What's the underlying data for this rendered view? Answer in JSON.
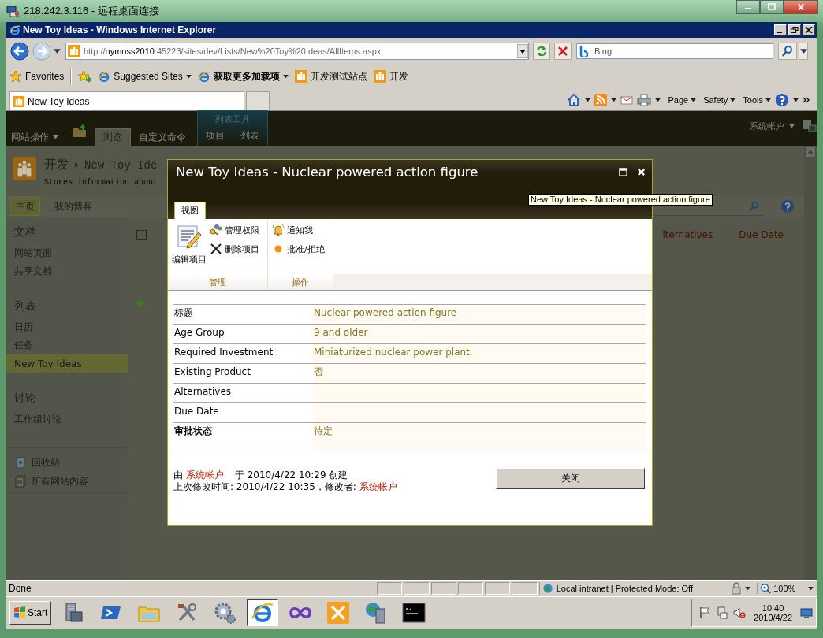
{
  "remote_window": {
    "title": "218.242.3.116 - 远程桌面连接"
  },
  "browser": {
    "title": "New Toy Ideas - Windows Internet Explorer",
    "address": {
      "prefix": "http://",
      "host": "nymoss2010",
      "path": ":45223/sites/dev/Lists/New%20Toy%20Ideas/AllItems.aspx"
    },
    "search": {
      "placeholder": "Bing"
    },
    "favorites": [
      {
        "label": "Favorites",
        "kind": "star"
      },
      {
        "label": "Suggested Sites",
        "kind": "ie",
        "dropdown": true,
        "bold": false
      },
      {
        "label": "获取更多加载项",
        "kind": "ie",
        "dropdown": true,
        "bold": true
      },
      {
        "label": "开发测试站点",
        "kind": "site",
        "dropdown": false,
        "bold": false
      },
      {
        "label": "开发",
        "kind": "site",
        "dropdown": false,
        "bold": false
      }
    ],
    "tabs": [
      {
        "label": "New Toy Ideas",
        "selected": true
      }
    ],
    "commands": [
      "Page",
      "Safety",
      "Tools"
    ],
    "status_bar": {
      "status": "Done",
      "zone": "Local intranet | Protected Mode: Off",
      "zoom": "100%"
    }
  },
  "sharepoint": {
    "ribbon": {
      "site_actions": "网站操作",
      "tabs": [
        {
          "label": "浏览",
          "selected": true
        },
        {
          "label": "自定义命令",
          "selected": false
        }
      ],
      "context_group": {
        "title": "列表工具",
        "tabs": [
          {
            "label": "项目",
            "selected": false
          },
          {
            "label": "列表",
            "selected": false
          }
        ]
      },
      "user": "系统帐户"
    },
    "header": {
      "site": "开发",
      "list": "New Toy Ide",
      "description": "Stores information about"
    },
    "top_nav": [
      {
        "label": "主页",
        "selected": true
      },
      {
        "label": "我的博客",
        "selected": false
      }
    ],
    "quick_launch": [
      {
        "heading": "文档",
        "items": [
          {
            "label": "网站页面",
            "selected": false
          },
          {
            "label": "共享文档",
            "selected": false
          }
        ]
      },
      {
        "heading": "列表",
        "items": [
          {
            "label": "日历",
            "selected": false
          },
          {
            "label": "任务",
            "selected": false
          },
          {
            "label": "New Toy Ideas",
            "selected": true
          }
        ]
      },
      {
        "heading": "讨论",
        "items": [
          {
            "label": "工作组讨论",
            "selected": false
          }
        ]
      }
    ],
    "bottom_links": [
      {
        "label": "回收站",
        "kind": "recycle"
      },
      {
        "label": "所有网站内容",
        "kind": "pages"
      }
    ],
    "select_all": {
      "checked": false
    },
    "columns": [
      "lternatives",
      "Due Date"
    ]
  },
  "dialog": {
    "title": "New Toy Ideas - Nuclear powered action figure",
    "tab": "视图",
    "groups": [
      {
        "label": "管理",
        "large": {
          "label": "编辑项目",
          "kind": "edit"
        },
        "buttons": [
          {
            "label": "管理权限",
            "kind": "permissions"
          },
          {
            "label": "删除项目",
            "kind": "delete"
          }
        ]
      },
      {
        "label": "操作",
        "buttons": [
          {
            "label": "通知我",
            "kind": "alert"
          },
          {
            "label": "批准/拒绝",
            "kind": "approve"
          }
        ]
      }
    ],
    "fields": [
      {
        "label": "标题",
        "value": "Nuclear powered action figure",
        "bold": false
      },
      {
        "label": "Age Group",
        "value": "9 and older",
        "bold": false
      },
      {
        "label": "Required Investment",
        "value": "Miniaturized nuclear power plant.",
        "bold": false
      },
      {
        "label": "Existing Product",
        "value": "否",
        "bold": false
      },
      {
        "label": "Alternatives",
        "bold": false
      },
      {
        "label": "Due Date",
        "bold": false
      },
      {
        "label": "审批状态",
        "value": "待定",
        "bold": true
      }
    ],
    "created": {
      "prefix": "由",
      "author": "系统帐户",
      "text": "于 2010/4/22 10:29 创建"
    },
    "modified": {
      "text": "上次修改时间: 2010/4/22 10:35，修改者:",
      "author": "系统帐户"
    },
    "close_button": "关闭"
  },
  "tooltip": "New Toy Ideas - Nuclear powered action figure",
  "taskbar": {
    "start": "Start",
    "apps": [
      {
        "kind": "server",
        "selected": false
      },
      {
        "kind": "shell",
        "selected": false
      },
      {
        "kind": "folder",
        "selected": false
      },
      {
        "kind": "tools",
        "selected": false
      },
      {
        "kind": "gear",
        "selected": false
      },
      {
        "kind": "ie",
        "selected": true
      },
      {
        "kind": "infinity",
        "selected": false
      },
      {
        "kind": "toolkit",
        "selected": false
      },
      {
        "kind": "globe",
        "selected": false
      },
      {
        "kind": "console",
        "selected": false
      }
    ],
    "time": "10:40",
    "date": "2010/4/22"
  }
}
